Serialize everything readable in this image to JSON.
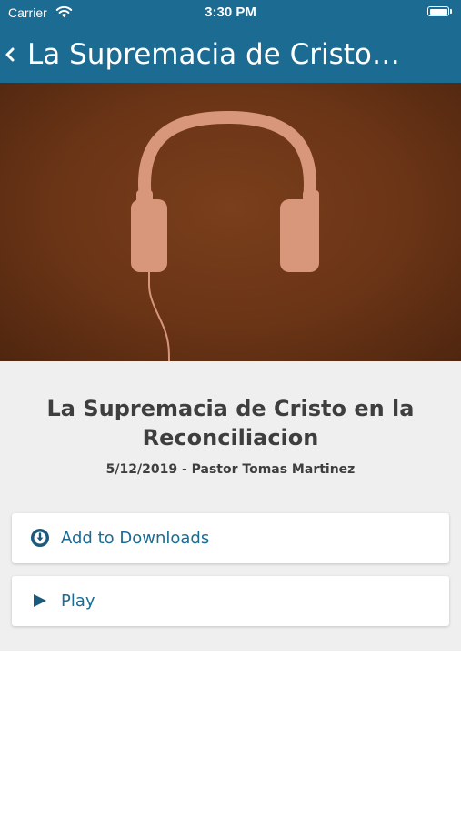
{
  "status_bar": {
    "carrier": "Carrier",
    "time": "3:30 PM",
    "battery_level": 1.0
  },
  "nav": {
    "back_icon": "chevron-left-icon",
    "title": "La Supremacia de Cristo…"
  },
  "hero": {
    "image": "headphones-illustration",
    "colors": {
      "background": "#6a3416",
      "headphones": "#d8967a"
    }
  },
  "sermon": {
    "title_line1": "La Supremacia de Cristo en la",
    "title_line2": "Reconciliacion",
    "meta": "5/12/2019 - Pastor Tomas Martinez"
  },
  "actions": [
    {
      "icon": "download-circle-icon",
      "label": "Add to Downloads"
    },
    {
      "icon": "play-icon",
      "label": "Play"
    }
  ],
  "colors": {
    "accent": "#1c6b93",
    "panel_background": "#efefef",
    "card_background": "#ffffff",
    "title_text": "#3e3e3e"
  }
}
